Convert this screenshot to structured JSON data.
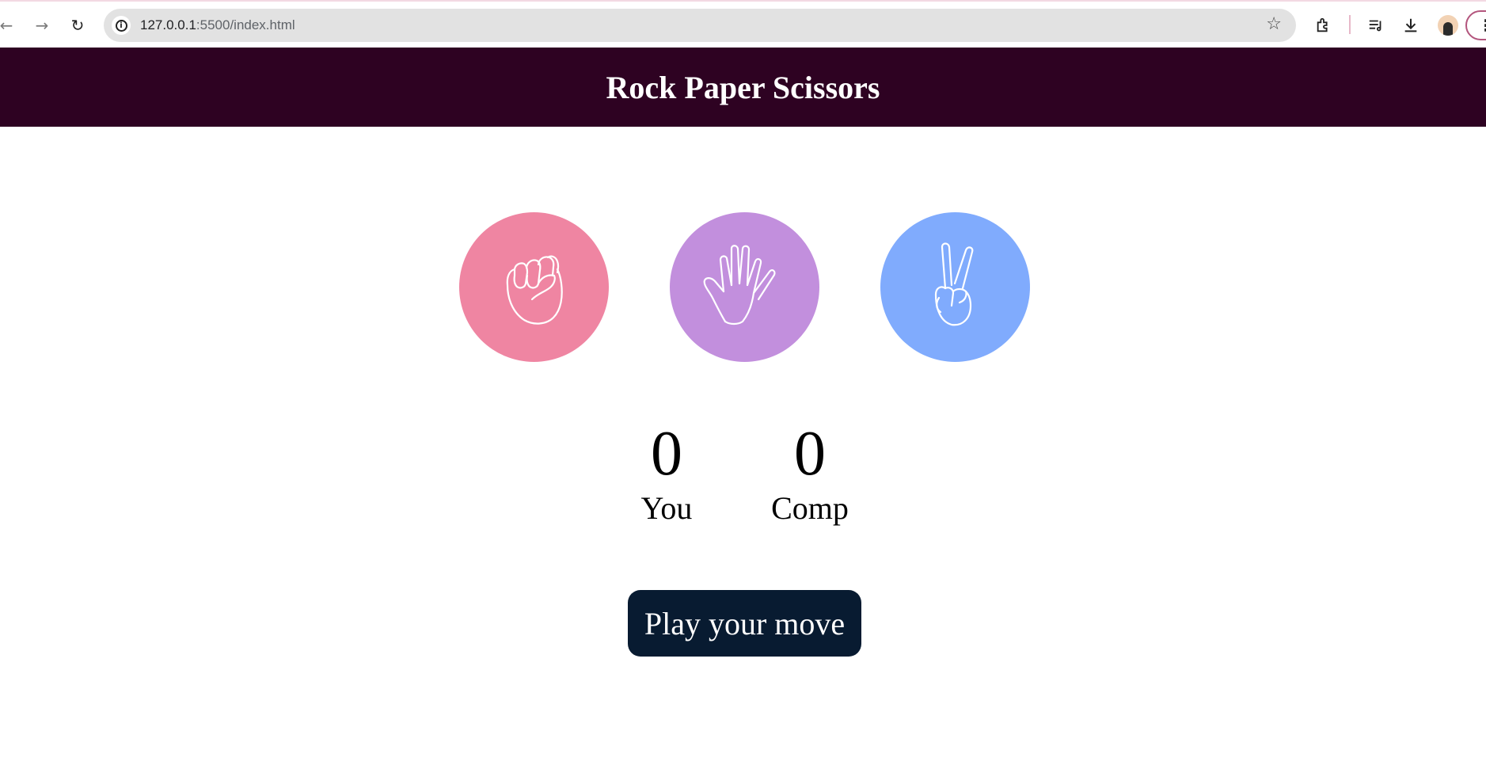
{
  "browser": {
    "url_host": "127.0.0.1",
    "url_path": ":5500/index.html",
    "icons": {
      "back": "back-arrow-icon",
      "forward": "forward-arrow-icon",
      "reload": "reload-icon",
      "site_info": "info-icon",
      "bookmark": "star-icon",
      "extensions": "puzzle-icon",
      "media": "media-queue-icon",
      "downloads": "download-icon",
      "profile": "avatar",
      "menu": "kebab-menu-icon"
    }
  },
  "page": {
    "title": "Rock Paper Scissors",
    "header_color": "#2e0222",
    "choices": [
      {
        "id": "rock",
        "icon": "fist-icon",
        "color": "#ef85a2"
      },
      {
        "id": "paper",
        "icon": "open-hand-icon",
        "color": "#c28fdd"
      },
      {
        "id": "scissors",
        "icon": "peace-hand-icon",
        "color": "#80abfd"
      }
    ],
    "score": {
      "user_score": "0",
      "user_label": "You",
      "comp_score": "0",
      "comp_label": "Comp"
    },
    "message": "Play your move",
    "message_color": "#081b31"
  }
}
